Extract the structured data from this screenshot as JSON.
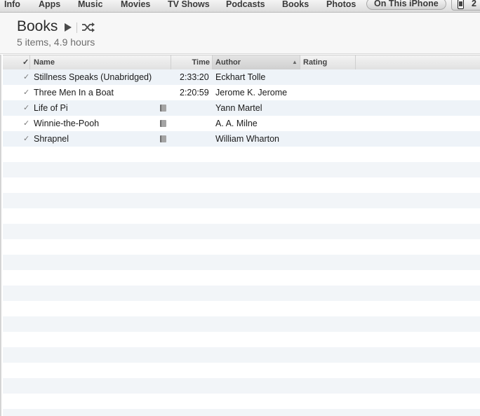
{
  "tabs": [
    {
      "label": "Info",
      "active": false
    },
    {
      "label": "Apps",
      "active": false
    },
    {
      "label": "Music",
      "active": false
    },
    {
      "label": "Movies",
      "active": false
    },
    {
      "label": "TV Shows",
      "active": false
    },
    {
      "label": "Podcasts",
      "active": false
    },
    {
      "label": "Books",
      "active": false
    },
    {
      "label": "Photos",
      "active": false
    },
    {
      "label": "On This iPhone",
      "active": true
    }
  ],
  "device": {
    "count": "2",
    "icon": "iphone-icon"
  },
  "header": {
    "title": "Books",
    "subtitle": "5 items, 4.9 hours",
    "play_icon": "play-icon",
    "shuffle_icon": "shuffle-icon"
  },
  "table": {
    "columns": {
      "check": "✓",
      "name": "Name",
      "time": "Time",
      "author": "Author",
      "rating": "Rating",
      "sort_indicator": "▲"
    },
    "rows": [
      {
        "check": "✓",
        "name": "Stillness Speaks (Unabridged)",
        "time": "2:33:20",
        "author": "Eckhart Tolle",
        "ebook": false
      },
      {
        "check": "✓",
        "name": "Three Men In a Boat",
        "time": "2:20:59",
        "author": "Jerome K. Jerome",
        "ebook": false
      },
      {
        "check": "✓",
        "name": "Life of Pi",
        "time": "",
        "author": "Yann Martel",
        "ebook": true
      },
      {
        "check": "✓",
        "name": "Winnie-the-Pooh",
        "time": "",
        "author": "A. A. Milne",
        "ebook": true
      },
      {
        "check": "✓",
        "name": "Shrapnel",
        "time": "",
        "author": "William Wharton",
        "ebook": true
      }
    ]
  },
  "colors": {
    "row_stripe": "#eef3f8",
    "text": "#1a1a1a",
    "subtitle": "#6d6d6d"
  }
}
